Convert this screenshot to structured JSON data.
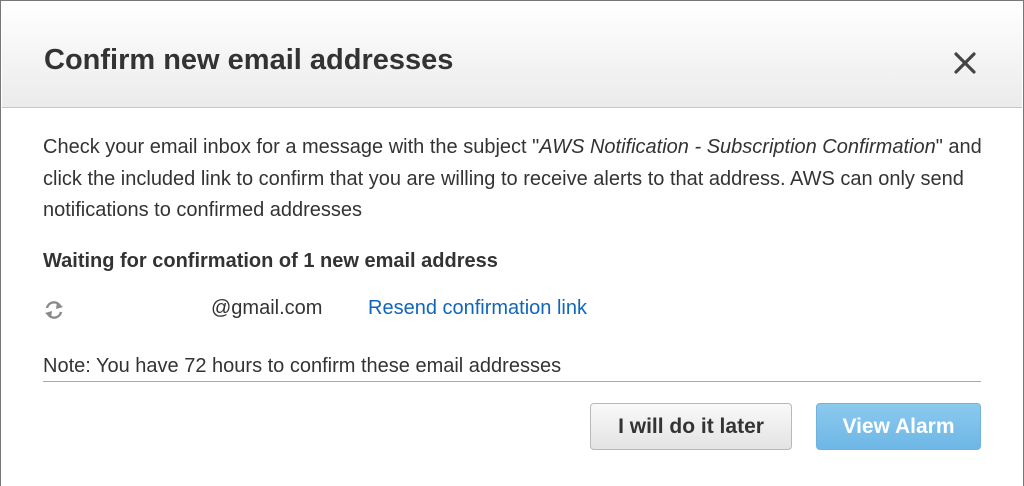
{
  "dialog": {
    "title": "Confirm new email addresses",
    "close_icon": "close-icon"
  },
  "message": {
    "part1": "Check your email inbox for a message with the subject \"",
    "subject": "AWS Notification - Subscription Confirmation",
    "part2": "\" and click the included link to confirm that you are willing to receive alerts to that address. AWS can only send notifications to confirmed addresses"
  },
  "waiting_heading": "Waiting for confirmation of 1 new email address",
  "pending": [
    {
      "icon": "refresh-icon",
      "email_domain": "@gmail.com",
      "resend_label": "Resend confirmation link"
    }
  ],
  "note": "Note: You have 72 hours to confirm these email addresses",
  "buttons": {
    "later_label": "I will do it later",
    "view_alarm_label": "View Alarm"
  },
  "colors": {
    "link": "#1166bb",
    "primary_button": "#7abfe9",
    "text": "#333333"
  }
}
